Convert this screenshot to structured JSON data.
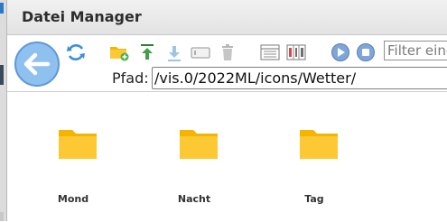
{
  "window": {
    "title": "Datei Manager"
  },
  "toolbar": {
    "back_icon": "arrow-left-icon",
    "refresh_icon": "refresh-icon",
    "new_folder_icon": "folder-add-icon",
    "upload_icon": "upload-icon",
    "download_icon": "download-icon",
    "rename_icon": "rename-icon",
    "delete_icon": "trash-icon",
    "list_view_icon": "list-view-icon",
    "table_view_icon": "table-view-icon",
    "play_icon": "play-icon",
    "stop_icon": "stop-icon",
    "filter_placeholder": "Filter eing",
    "filter_value": ""
  },
  "path": {
    "label": "Pfad:",
    "value": "/vis.0/2022ML/icons/Wetter/"
  },
  "folders": [
    {
      "name": "Mond",
      "icon": "folder-icon"
    },
    {
      "name": "Nacht",
      "icon": "folder-icon"
    },
    {
      "name": "Tag",
      "icon": "folder-icon"
    }
  ],
  "colors": {
    "accent": "#5d98d8",
    "folder": "#fcc934",
    "folder_tab": "#f5b400"
  }
}
